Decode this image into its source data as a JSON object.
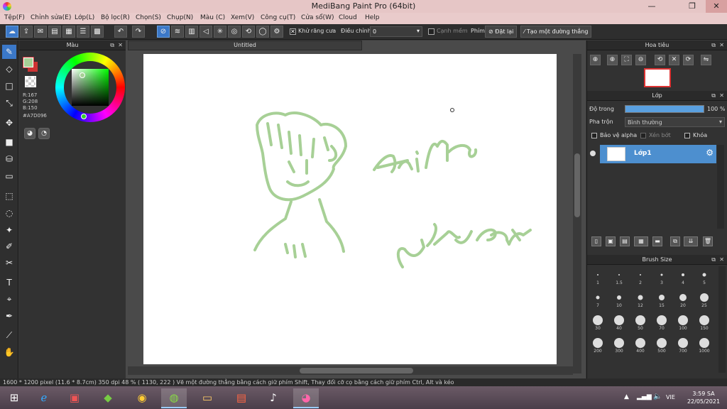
{
  "window": {
    "title": "MediBang Paint Pro (64bit)",
    "minimize": "—",
    "maximize": "❐",
    "close": "✕"
  },
  "menu": [
    "Tệp(F)",
    "Chỉnh sửa(E)",
    "Lớp(L)",
    "Bộ lọc(R)",
    "Chọn(S)",
    "Chụp(N)",
    "Màu (C)",
    "Xem(V)",
    "Công cụ(T)",
    "Cửa sổ(W)",
    "Cloud",
    "Help"
  ],
  "toolbar": {
    "antialias_label": "Khử răng cưa",
    "adjust_label": "Điều chỉnh",
    "adjust_value": "0",
    "edge_label": "Cạnh mềm",
    "key_label": "Phím",
    "reset_label": "Đặt lại",
    "straight_line_label": "Tạo một đường thẳng"
  },
  "color_panel": {
    "title": "Màu",
    "r": "R:167",
    "g": "G:208",
    "b": "B:150",
    "hex": "#A7D096",
    "current_color": "#a7d096"
  },
  "canvas": {
    "tab_title": "Untitled",
    "stroke_color": "#a7d096",
    "drawn_text_1": "AniMe",
    "drawn_text_2": "Chuy2k7"
  },
  "navigator": {
    "title": "Hoa tiêu"
  },
  "layer_panel": {
    "title": "Lớp",
    "opacity_label": "Độ trong",
    "opacity_value": "100 %",
    "opacity_fraction": 1.0,
    "blend_label": "Pha trộn",
    "blend_value": "Bình thường",
    "protect_alpha_label": "Bảo vệ alpha",
    "clipping_label": "Xén bớt",
    "lock_label": "Khóa",
    "layer_name": "Lớp1"
  },
  "brush_size": {
    "title": "Brush Size",
    "sizes": [
      "1",
      "1.5",
      "2",
      "3",
      "4",
      "5",
      "7",
      "10",
      "12",
      "15",
      "20",
      "25",
      "30",
      "40",
      "50",
      "70",
      "100",
      "150",
      "200",
      "300",
      "400",
      "500",
      "700",
      "1000"
    ]
  },
  "status": {
    "text": "1600 * 1200 pixel   (11.6 * 8.7cm)   350 dpi   48 %   ( 1130, 222 )   Vẽ một đường thẳng bằng cách giữ phím Shift, Thay đổi cỡ cọ bằng cách giữ phím Ctrl, Alt và kéo"
  },
  "taskbar": {
    "language": "VIE",
    "time": "3:59 SA",
    "date": "22/05/2021"
  }
}
